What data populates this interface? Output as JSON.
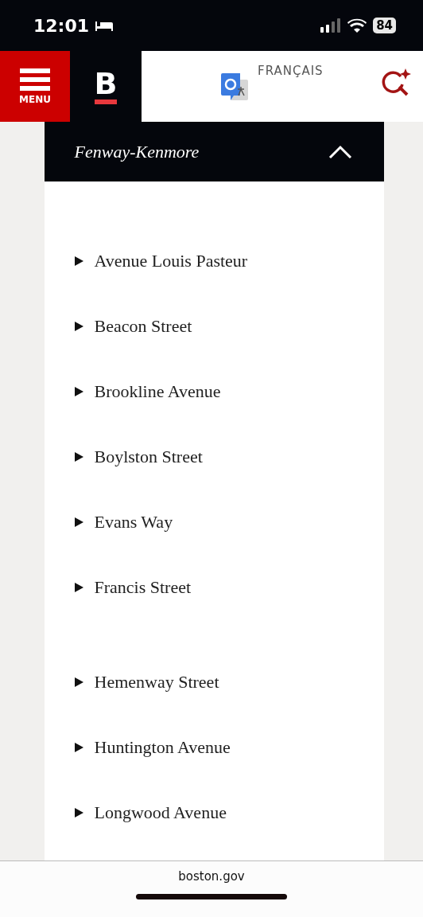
{
  "status_bar": {
    "time": "12:01",
    "battery": "84"
  },
  "header": {
    "menu_label": "MENU",
    "logo_letter": "B",
    "language": "FRANÇAIS"
  },
  "section": {
    "title": "Fenway-Kenmore",
    "expanded": true,
    "groups": [
      {
        "streets": [
          "Avenue Louis Pasteur",
          "Beacon Street",
          "Brookline Avenue",
          "Boylston Street",
          "Evans Way",
          "Francis Street"
        ]
      },
      {
        "streets": [
          "Hemenway Street",
          "Huntington Avenue",
          "Longwood Avenue"
        ]
      }
    ]
  },
  "browser_bar": {
    "url": "boston.gov"
  }
}
